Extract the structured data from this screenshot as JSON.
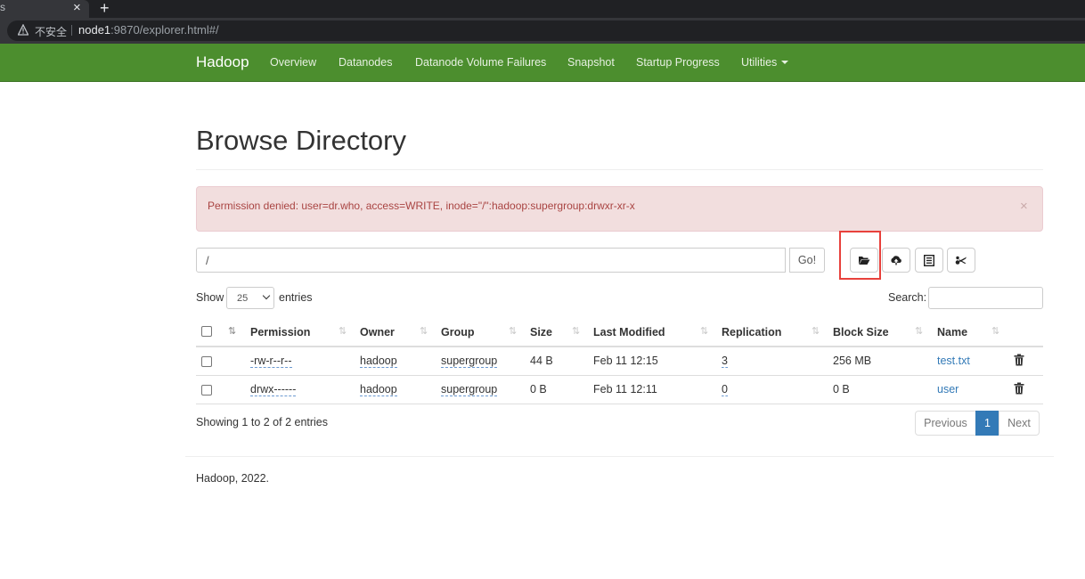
{
  "browser": {
    "tab_close": "×",
    "new_tab": "+",
    "security_label": "不安全",
    "url_host": "node1",
    "url_rest": ":9870/explorer.html#/"
  },
  "navbar": {
    "brand": "Hadoop",
    "links": [
      "Overview",
      "Datanodes",
      "Datanode Volume Failures",
      "Snapshot",
      "Startup Progress",
      "Utilities"
    ]
  },
  "page": {
    "title": "Browse Directory",
    "alert": "Permission denied: user=dr.who, access=WRITE, inode=\"/\":hadoop:supergroup:drwxr-xr-x",
    "alert_close": "×",
    "path_value": "/",
    "go_label": "Go!",
    "toolbar_icons": [
      "create-directory-icon",
      "upload-icon",
      "cut-paste-icon",
      "delete-selected-icon"
    ]
  },
  "table_controls": {
    "show_label": "Show",
    "entries_value": "25",
    "entries_label": "entries",
    "search_label": "Search:",
    "search_value": ""
  },
  "table": {
    "columns": [
      "Permission",
      "Owner",
      "Group",
      "Size",
      "Last Modified",
      "Replication",
      "Block Size",
      "Name"
    ],
    "rows": [
      {
        "permission": "-rw-r--r--",
        "owner": "hadoop",
        "group": "supergroup",
        "size": "44 B",
        "modified": "Feb 11 12:15",
        "replication": "3",
        "block_size": "256 MB",
        "name": "test.txt"
      },
      {
        "permission": "drwx------",
        "owner": "hadoop",
        "group": "supergroup",
        "size": "0 B",
        "modified": "Feb 11 12:11",
        "replication": "0",
        "block_size": "0 B",
        "name": "user"
      }
    ],
    "info": "Showing 1 to 2 of 2 entries",
    "pagination": {
      "previous": "Previous",
      "current": "1",
      "next": "Next"
    }
  },
  "footer": "Hadoop, 2022.",
  "colors": {
    "navbar": "#4c8e2e",
    "alert_bg": "#f2dede",
    "alert_text": "#a94442",
    "link": "#337ab7",
    "highlight": "#e8413c"
  }
}
